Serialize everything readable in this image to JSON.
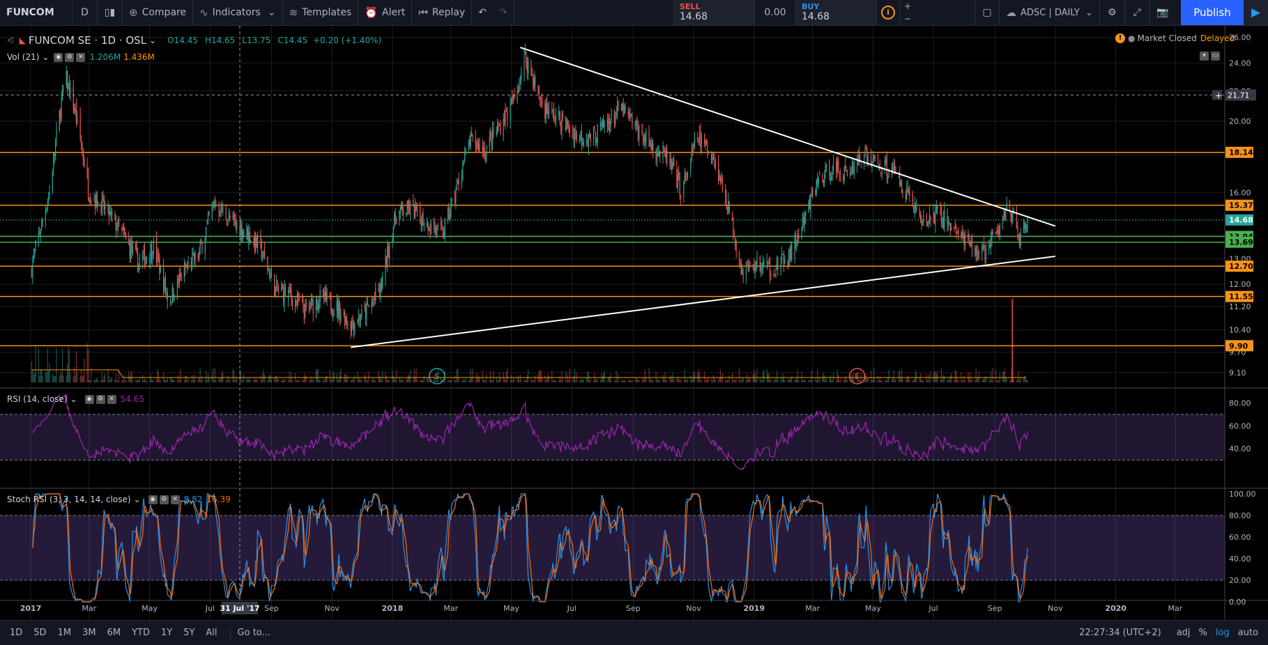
{
  "toolbar": {
    "symbol": "FUNCOM",
    "interval": "D",
    "compare": "Compare",
    "indicators": "Indicators",
    "templates": "Templates",
    "alert": "Alert",
    "replay": "Replay",
    "sell_label": "SELL",
    "sell_price": "14.68",
    "spread": "0.00",
    "buy_label": "BUY",
    "buy_price": "14.68",
    "layout_name": "ADSC | DAILY",
    "publish": "Publish"
  },
  "legend": {
    "title": "FUNCOM SE · 1D · OSL",
    "open": "O14.45",
    "high": "H14.65",
    "low": "L13.75",
    "close": "C14.45",
    "change": "+0.20 (+1.40%)",
    "vol_label": "Vol (21)",
    "vol_value1": "1.206M",
    "vol_value2": "1.436M",
    "rsi_label": "RSI (14, close)",
    "rsi_value": "54.65",
    "stoch_label": "Stoch RSI (3, 3, 14, 14, close)",
    "stoch_k": "8.82",
    "stoch_d": "16.39",
    "market_status": "Market Closed",
    "delayed": "Delayed"
  },
  "colors": {
    "up": "#26a69a",
    "down": "#ef5350",
    "orange_level": "#f7931a",
    "green_level": "#4caf50",
    "rsi": "#9c27b0",
    "stoch_k": "#2196f3",
    "stoch_d": "#ff6d00"
  },
  "chart_data": [
    {
      "type": "candlestick",
      "title": "FUNCOM SE · 1D · OSL",
      "scale": "log",
      "ylim": [
        9.0,
        26.5
      ],
      "y_ticks": [
        "26.00",
        "24.00",
        "22.00",
        "20.00",
        "18.00",
        "16.00",
        "14.00",
        "13.00",
        "12.00",
        "11.20",
        "10.40",
        "9.70",
        "9.10"
      ],
      "x_ticks": [
        "2017",
        "Mar",
        "May",
        "Jul",
        "Sep",
        "Nov",
        "2018",
        "Mar",
        "May",
        "Jul",
        "Sep",
        "Nov",
        "2019",
        "Mar",
        "May",
        "Jul",
        "Sep",
        "Nov",
        "2020",
        "Mar"
      ],
      "crosshair_date": "31 Jul '17",
      "crosshair_price": "21.71",
      "last_price": "14.68",
      "levels": [
        {
          "price": 18.14,
          "label": "18.14",
          "color": "orange"
        },
        {
          "price": 15.37,
          "label": "15.37",
          "color": "orange"
        },
        {
          "price": 13.94,
          "label": "13.94",
          "color": "green"
        },
        {
          "price": 13.69,
          "label": "13.69",
          "color": "green"
        },
        {
          "price": 12.7,
          "label": "12.70",
          "color": "orange"
        },
        {
          "price": 11.55,
          "label": "11.55",
          "color": "orange"
        },
        {
          "price": 9.9,
          "label": "9.90",
          "color": "orange"
        }
      ],
      "trendlines": [
        {
          "from": [
            "2018-05-10",
            25.2
          ],
          "to": [
            "2019-11-01",
            14.4
          ]
        },
        {
          "from": [
            "2017-11-20",
            9.85
          ],
          "to": [
            "2019-11-01",
            13.1
          ]
        }
      ],
      "events": [
        {
          "date": "2018-02-15",
          "label": "S"
        },
        {
          "date": "2019-04-15",
          "label": "E"
        }
      ],
      "price_path": [
        [
          "2017-01-01",
          12.5
        ],
        [
          "2017-01-20",
          16.0
        ],
        [
          "2017-02-05",
          23.0
        ],
        [
          "2017-02-15",
          20.5
        ],
        [
          "2017-03-01",
          16.0
        ],
        [
          "2017-03-15",
          15.3
        ],
        [
          "2017-04-01",
          14.2
        ],
        [
          "2017-04-20",
          12.8
        ],
        [
          "2017-05-05",
          13.5
        ],
        [
          "2017-05-20",
          11.4
        ],
        [
          "2017-06-05",
          12.5
        ],
        [
          "2017-06-20",
          13.2
        ],
        [
          "2017-07-05",
          15.5
        ],
        [
          "2017-07-20",
          14.7
        ],
        [
          "2017-08-05",
          14.2
        ],
        [
          "2017-08-20",
          13.5
        ],
        [
          "2017-09-05",
          11.8
        ],
        [
          "2017-09-20",
          11.6
        ],
        [
          "2017-10-05",
          11.0
        ],
        [
          "2017-10-20",
          11.5
        ],
        [
          "2017-11-05",
          11.2
        ],
        [
          "2017-11-20",
          10.6
        ],
        [
          "2017-12-05",
          11.0
        ],
        [
          "2017-12-20",
          11.8
        ],
        [
          "2018-01-05",
          15.0
        ],
        [
          "2018-01-20",
          15.2
        ],
        [
          "2018-02-05",
          14.6
        ],
        [
          "2018-02-20",
          14.0
        ],
        [
          "2018-03-05",
          15.8
        ],
        [
          "2018-03-20",
          18.8
        ],
        [
          "2018-04-05",
          18.3
        ],
        [
          "2018-04-20",
          19.8
        ],
        [
          "2018-05-05",
          21.5
        ],
        [
          "2018-05-15",
          24.5
        ],
        [
          "2018-06-01",
          21.0
        ],
        [
          "2018-06-20",
          20.0
        ],
        [
          "2018-07-05",
          19.2
        ],
        [
          "2018-07-20",
          19.0
        ],
        [
          "2018-08-05",
          19.8
        ],
        [
          "2018-08-20",
          20.8
        ],
        [
          "2018-09-05",
          19.5
        ],
        [
          "2018-09-20",
          18.5
        ],
        [
          "2018-10-05",
          17.8
        ],
        [
          "2018-10-20",
          16.0
        ],
        [
          "2018-11-05",
          19.0
        ],
        [
          "2018-11-20",
          18.0
        ],
        [
          "2018-12-05",
          15.5
        ],
        [
          "2018-12-20",
          12.5
        ],
        [
          "2019-01-05",
          12.8
        ],
        [
          "2019-01-20",
          12.6
        ],
        [
          "2019-02-05",
          13.0
        ],
        [
          "2019-02-20",
          14.5
        ],
        [
          "2019-03-05",
          16.5
        ],
        [
          "2019-03-20",
          17.3
        ],
        [
          "2019-04-05",
          17.0
        ],
        [
          "2019-04-20",
          18.0
        ],
        [
          "2019-05-05",
          17.5
        ],
        [
          "2019-05-20",
          17.2
        ],
        [
          "2019-06-05",
          16.0
        ],
        [
          "2019-06-20",
          14.5
        ],
        [
          "2019-07-05",
          15.0
        ],
        [
          "2019-07-20",
          14.4
        ],
        [
          "2019-08-05",
          13.5
        ],
        [
          "2019-08-20",
          13.2
        ],
        [
          "2019-09-05",
          14.2
        ],
        [
          "2019-09-15",
          15.6
        ],
        [
          "2019-09-25",
          13.8
        ],
        [
          "2019-10-05",
          14.45
        ]
      ]
    },
    {
      "type": "line",
      "title": "RSI (14, close)",
      "ylim": [
        20,
        90
      ],
      "y_ticks": [
        "80.00",
        "60.00",
        "40.00"
      ],
      "bands": [
        70,
        30
      ],
      "last": 54.65
    },
    {
      "type": "line",
      "title": "Stoch RSI (3, 3, 14, 14, close)",
      "ylim": [
        0,
        100
      ],
      "y_ticks": [
        "100.00",
        "80.00",
        "60.00",
        "40.00",
        "20.00",
        "0.00"
      ],
      "bands": [
        80,
        20
      ],
      "series": [
        {
          "name": "K",
          "last": 8.82
        },
        {
          "name": "D",
          "last": 16.39
        }
      ]
    }
  ],
  "bottombar": {
    "ranges": [
      "1D",
      "5D",
      "1M",
      "3M",
      "6M",
      "YTD",
      "1Y",
      "5Y",
      "All"
    ],
    "goto": "Go to...",
    "time": "22:27:34 (UTC+2)",
    "adj": "adj",
    "percent": "%",
    "log": "log",
    "auto": "auto"
  }
}
